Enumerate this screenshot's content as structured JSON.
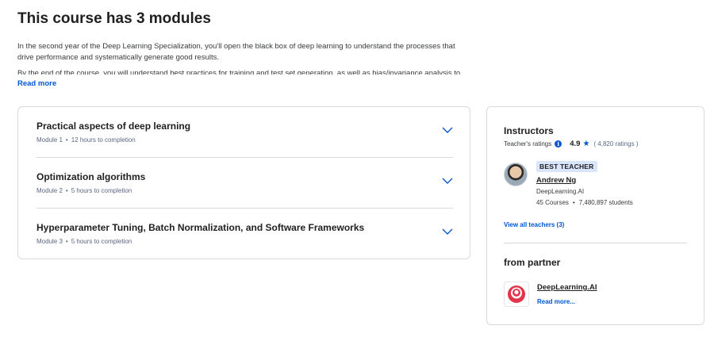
{
  "page": {
    "title": "This course has 3 modules"
  },
  "description": {
    "para1": "In the second year of the Deep Learning Specialization, you'll open the black box of deep learning to understand the processes that drive performance and systematically generate good results.",
    "para2": "By the end of the course, you will understand best practices for training and test set generation, as well as bias/invariance analysis to",
    "read_more": "Read more"
  },
  "modules": [
    {
      "title": "Practical aspects of deep learning",
      "number": "Module 1",
      "duration": "12 hours to completion"
    },
    {
      "title": "Optimization algorithms",
      "number": "Module 2",
      "duration": "5 hours to completion"
    },
    {
      "title": "Hyperparameter Tuning, Batch Normalization, and Software Frameworks",
      "number": "Module 3",
      "duration": "5 hours to completion"
    }
  ],
  "meta_separator": "•",
  "instructors": {
    "heading": "Instructors",
    "ratings_label": "Teacher's ratings",
    "rating": "4.9",
    "rating_count": "( 4,820 ratings )",
    "teacher": {
      "badge": "BEST TEACHER",
      "name": "Andrew Ng",
      "org": "DeepLearning.AI",
      "courses": "45 Courses",
      "students": "7,480,897 students"
    },
    "view_all": "View all teachers (3)"
  },
  "partner": {
    "heading": "from partner",
    "name": "DeepLearning.AI",
    "read_more": "Read more..."
  },
  "colors": {
    "accent": "#0056d2",
    "border": "#dadada",
    "badge_bg": "#d9e5fb",
    "logo_red": "#e3344b"
  },
  "icons": {
    "chevron": "chevron-down-icon",
    "info": "info-icon",
    "star": "star-icon"
  }
}
